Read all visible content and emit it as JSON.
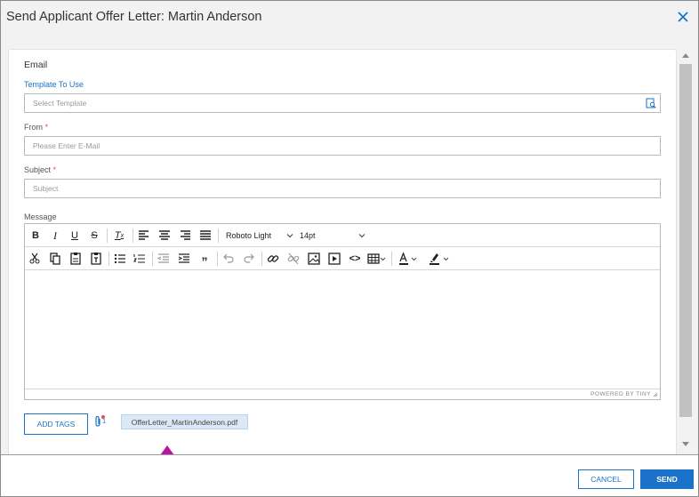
{
  "dialog": {
    "title": "Send Applicant Offer Letter: Martin Anderson",
    "close_icon": "close-x-icon"
  },
  "form": {
    "section_title": "Email",
    "template": {
      "label": "Template To Use",
      "placeholder": "Select Template",
      "icon": "template-search-icon"
    },
    "from": {
      "label": "From",
      "required": "*",
      "placeholder": "Please Enter E-Mail"
    },
    "subject": {
      "label": "Subject",
      "required": "*",
      "placeholder": "Subject"
    },
    "message": {
      "label": "Message"
    }
  },
  "editor": {
    "font_family": "Roboto Light",
    "font_size": "14pt",
    "powered_by": "POWERED BY TINY",
    "toolbar_row1": [
      "bold-icon",
      "italic-icon",
      "underline-icon",
      "strikethrough-icon",
      "clear-format-icon",
      "align-left-icon",
      "align-center-icon",
      "align-right-icon",
      "align-justify-icon"
    ],
    "toolbar_row2": [
      "cut-icon",
      "copy-icon",
      "paste-icon",
      "paste-text-icon",
      "bullet-list-icon",
      "numbered-list-icon",
      "outdent-icon",
      "indent-icon",
      "blockquote-icon",
      "undo-icon",
      "redo-icon",
      "link-icon",
      "unlink-icon",
      "image-icon",
      "media-icon",
      "code-icon",
      "table-icon",
      "text-color-icon",
      "highlight-icon"
    ]
  },
  "attachments": {
    "add_tags_label": "ADD TAGS",
    "count": "1",
    "file_name": "OfferLetter_MartinAnderson.pdf",
    "icon": "paperclip-icon"
  },
  "annotation": {
    "arrow_color": "#b5179e"
  },
  "footer": {
    "cancel_label": "CANCEL",
    "send_label": "SEND"
  },
  "colors": {
    "accent": "#1a73c8",
    "required": "#d9534f"
  }
}
